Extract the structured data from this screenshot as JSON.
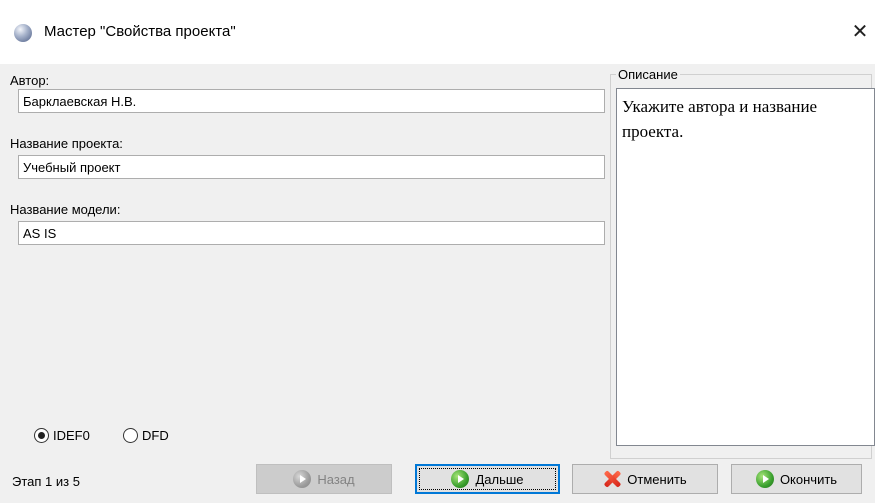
{
  "window": {
    "title": "Мастер \"Свойства проекта\"",
    "close_glyph": "✕",
    "app_icon": "app-sphere-icon"
  },
  "form": {
    "author": {
      "label": "Автор:",
      "value": "Барклаевская Н.В."
    },
    "project_name": {
      "label": "Название проекта:",
      "value": "Учебный проект"
    },
    "model_name": {
      "label": "Название модели:",
      "value": "AS IS"
    }
  },
  "description": {
    "legend": "Описание",
    "text": "Укажите автора и название проекта."
  },
  "methodology": {
    "options": [
      {
        "label": "IDEF0",
        "checked": true
      },
      {
        "label": "DFD",
        "checked": false
      }
    ]
  },
  "footer": {
    "step_text": "Этап 1 из 5",
    "buttons": {
      "back": "Назад",
      "next": "Дальше",
      "cancel": "Отменить",
      "finish": "Окончить"
    }
  },
  "colors": {
    "focus_border": "#0078d7",
    "dialog_bg": "#f0f0f0",
    "go_icon_green": "#3aa02e",
    "cancel_icon_red": "#d7261a"
  }
}
